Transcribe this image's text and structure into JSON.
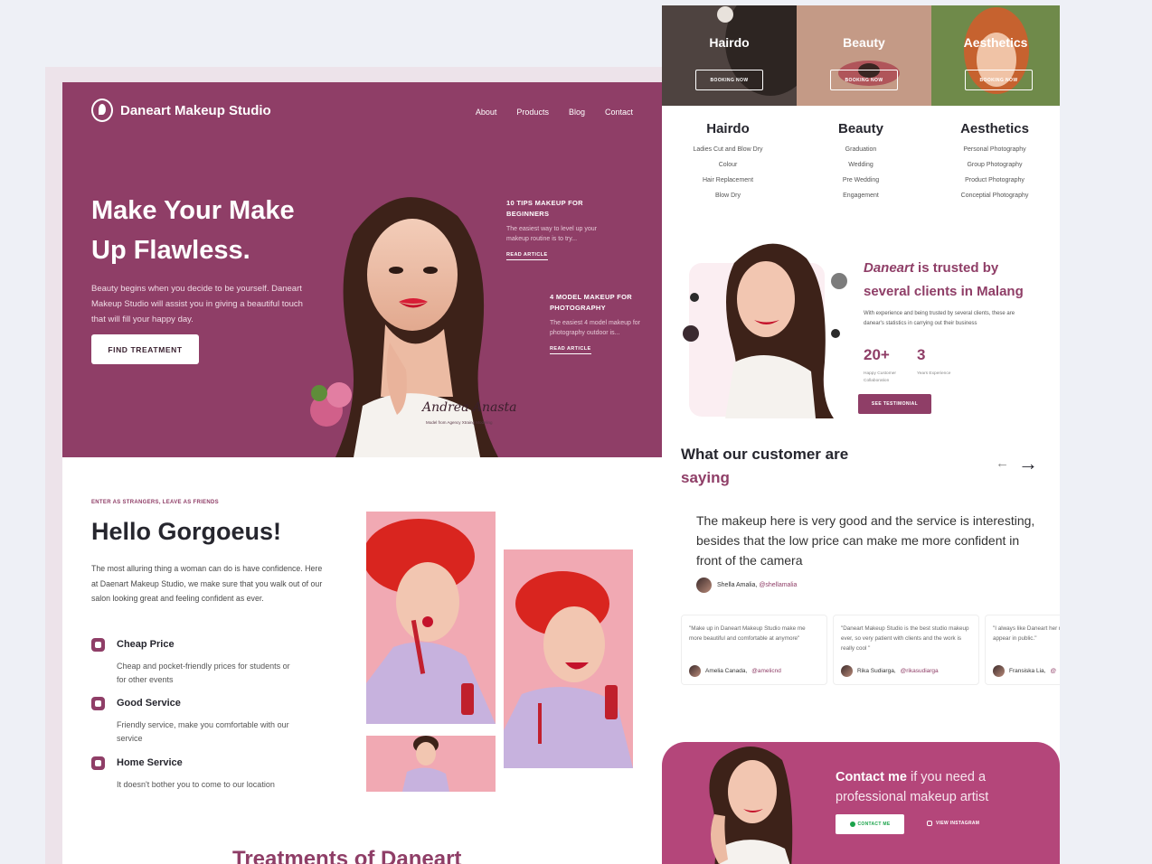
{
  "left": {
    "brand": "Daneart Makeup Studio",
    "nav": [
      "About",
      "Products",
      "Blog",
      "Contact"
    ],
    "hero": {
      "title": "Make Your Make Up Flawless.",
      "description": "Beauty begins when you decide to be yourself. Daneart Makeup Studio will assist you in giving a beautiful touch that will fill your happy day.",
      "cta": "FIND TREATMENT",
      "signature": "Andrea Anastasia",
      "signature_caption": "Model from Agency Xtraing Modeling"
    },
    "tips": [
      {
        "title": "10 TIPS MAKEUP FOR BEGINNERS",
        "desc": "The easiest way to level up your makeup routine is to try...",
        "link": "READ ARTICLE"
      },
      {
        "title": "4 MODEL MAKEUP FOR PHOTOGRAPHY",
        "desc": "The easiest 4 model makeup for photography outdoor is...",
        "link": "READ ARTICLE"
      }
    ],
    "about": {
      "eyebrow": "ENTER AS STRANGERS, LEAVE AS FRIENDS",
      "title": "Hello Gorgoeus!",
      "description": "The most alluring thing a woman can do is have confidence. Here at Daenart Makeup Studio, we make sure that you walk out of our salon looking great and feeling confident as ever."
    },
    "features": [
      {
        "title": "Cheap Price",
        "desc": "Cheap and pocket-friendly prices for students or for other events"
      },
      {
        "title": "Good Service",
        "desc": "Friendly service, make you comfortable with our service"
      },
      {
        "title": "Home Service",
        "desc": "It doesn't bother you to come to our location"
      }
    ],
    "treatments_title": "Treatments of Daneart"
  },
  "right": {
    "banners": [
      {
        "title": "Hairdo",
        "button": "BOOKING NOW"
      },
      {
        "title": "Beauty",
        "button": "BOOKING NOW"
      },
      {
        "title": "Aesthetics",
        "button": "BOOKING NOW"
      }
    ],
    "services": [
      {
        "title": "Hairdo",
        "items": [
          "Ladies Cut and Blow Dry",
          "Colour",
          "Hair Replacement",
          "Blow Dry"
        ]
      },
      {
        "title": "Beauty",
        "items": [
          "Graduation",
          "Wedding",
          "Pre Wedding",
          "Engagement"
        ]
      },
      {
        "title": "Aesthetics",
        "items": [
          "Personal Photography",
          "Group Photography",
          "Product Photography",
          "Conceptial Photography"
        ]
      }
    ],
    "trust": {
      "brand": "Daneart",
      "title_rest": " is trusted by several clients in Malang",
      "description": "With experience and being trusted by several clients, these are danear's statistics in carrying out their business",
      "stats": [
        {
          "value": "20+",
          "label": "Happy Customer Collaboration"
        },
        {
          "value": "3",
          "label": "Years Experience"
        }
      ],
      "button": "SEE TESTIMONIAL"
    },
    "testimonials": {
      "title_start": "What our customer are ",
      "title_accent": "saying",
      "quote": "The makeup here is very good and the service is interesting, besides that the low price can make me more confident in front of the camera",
      "author": "Shella Amalia, ",
      "handle": "@shellamalia",
      "cards": [
        {
          "text": "\"Make up in Daneart Makeup Studio make me more beautiful and comfortable at anymore\"",
          "author": "Amelia Canada, ",
          "handle": "@amelicnd"
        },
        {
          "text": "\"Daneart Makeup Studio is the best studio makeup ever, so very patient with clients and the work is really cool \"",
          "author": "Rika Sudiarga, ",
          "handle": "@rikasudiarga"
        },
        {
          "text": "\"I always like Daneart her makeup can make appear in public.\"",
          "author": "Fransiska Lia, ",
          "handle": "@"
        }
      ]
    },
    "contact": {
      "title_bold": "Contact me",
      "title_rest": " if you need a professional makeup artist",
      "button": "CONTACT ME",
      "instagram": "VIEW INSTAGRAM"
    }
  },
  "colors": {
    "primary": "#8f3e67",
    "contact_bg": "#b4467a",
    "page_bg": "#eef0f6"
  }
}
